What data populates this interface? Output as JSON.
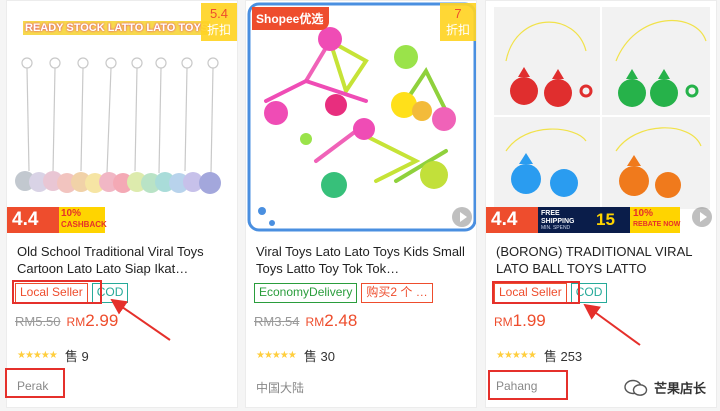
{
  "products": [
    {
      "banner": "READY STOCK LATTO LATO TOYS",
      "discount": "5.4",
      "discount_label": "折扣",
      "promo_big": "4.4",
      "promo_small": "10%",
      "promo_sub": "CASHBACK",
      "title": "Old School Traditional Viral Toys Cartoon Lato Lato Siap Ikat…",
      "badges": [
        "Local Seller",
        "COD"
      ],
      "old_price": "RM5.50",
      "currency": "RM",
      "price": "2.99",
      "sold_label": "售",
      "sold": "9",
      "location": "Perak"
    },
    {
      "brand": "Shopee优选",
      "discount": "7",
      "discount_label": "折扣",
      "title": "Viral Toys Lato Lato Toys Kids Small Toys Latto Toy Tok Tok…",
      "badges": [
        "EconomyDelivery",
        "购买2 个 …"
      ],
      "old_price": "RM3.54",
      "currency": "RM",
      "price": "2.48",
      "sold_label": "售",
      "sold": "30",
      "location": "中国大陆"
    },
    {
      "promo_big": "4.4",
      "promo_free": "FREE SHIPPING",
      "promo_min": "MIN. SPEND",
      "promo_amount": "15",
      "promo_small": "10%",
      "promo_sub": "REBATE NOW",
      "title": "(BORONG) TRADITIONAL VIRAL LATO BALL TOYS LATTO",
      "badges": [
        "Local Seller",
        "COD"
      ],
      "currency": "RM",
      "price": "1.99",
      "sold_label": "售",
      "sold": "253",
      "location": "Pahang"
    }
  ],
  "watermark": "芒果店长",
  "colors": {
    "shopee_orange": "#ee4d2d",
    "annotation_red": "#e5302b",
    "teal": "#26aa99",
    "star": "#ffce3d"
  }
}
